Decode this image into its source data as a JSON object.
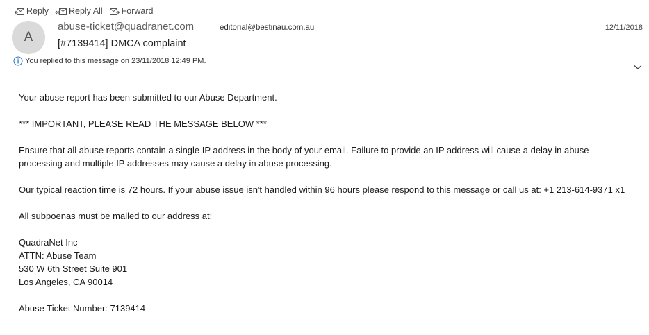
{
  "toolbar": {
    "reply_label": "Reply",
    "reply_all_label": "Reply All",
    "forward_label": "Forward"
  },
  "message": {
    "avatar_initial": "A",
    "sender": "abuse-ticket@quadranet.com",
    "recipient": "editorial@bestinau.com.au",
    "date": "12/11/2018",
    "subject": "[#7139414] DMCA complaint",
    "info": "You replied to this message on 23/11/2018 12:49 PM."
  },
  "body": {
    "paragraphs": [
      "Your abuse report has been submitted to our Abuse Department.",
      "*** IMPORTANT, PLEASE READ THE MESSAGE BELOW ***",
      "Ensure that all abuse reports contain a single IP address in the body of your email. Failure to provide an IP address will cause a delay in abuse processing and multiple IP addresses may cause a delay in abuse processing.",
      "Our typical reaction time is 72 hours. If your abuse issue isn't handled within 96 hours please respond to this message or call us at: +1 213-614-9371 x1",
      "All subpoenas must be mailed to our address at:",
      "QuadraNet Inc\nATTN: Abuse Team\n530 W 6th Street Suite 901\nLos Angeles, CA 90014",
      "Abuse Ticket Number: 7139414"
    ]
  },
  "colors": {
    "info_accent": "#2b79c2",
    "avatar_bg": "#dadada"
  }
}
